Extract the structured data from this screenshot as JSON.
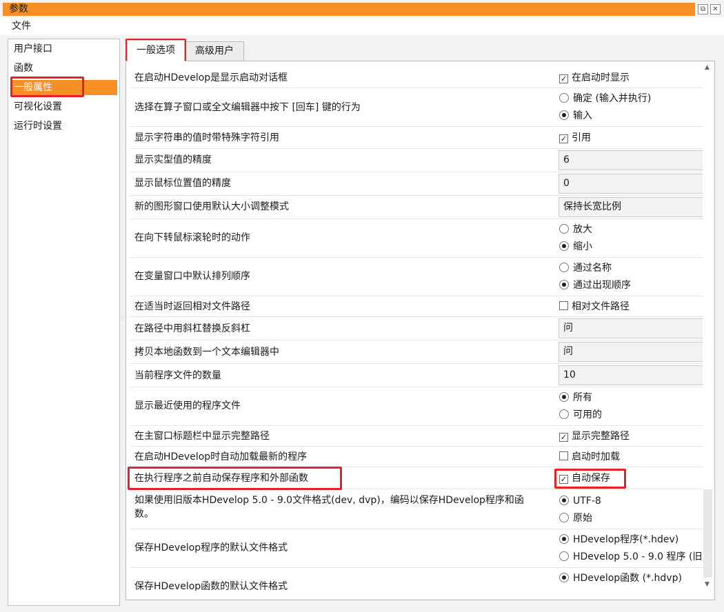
{
  "window": {
    "title": "参数",
    "restore_icon": "⧉",
    "close_icon": "✕"
  },
  "menu": {
    "file": "文件"
  },
  "sidebar": {
    "items": [
      {
        "label": "用户接口"
      },
      {
        "label": "函数"
      },
      {
        "label": "一般属性"
      },
      {
        "label": "可视化设置"
      },
      {
        "label": "运行时设置"
      }
    ]
  },
  "tabs": [
    {
      "label": "一般选项"
    },
    {
      "label": "高级用户"
    }
  ],
  "settings": [
    {
      "label": "在启动HDevelop是显示启动对话框",
      "checkbox_label": "在启动时显示",
      "checked": true
    },
    {
      "label": "选择在算子窗口或全文编辑器中按下 [回车] 键的行为",
      "options": [
        "确定 (输入并执行)",
        "输入"
      ],
      "selected": 1
    },
    {
      "label": "显示字符串的值时带特殊字符引用",
      "checkbox_label": "引用",
      "checked": true
    },
    {
      "label": "显示实型值的精度",
      "value": "6"
    },
    {
      "label": "显示鼠标位置值的精度",
      "value": "0"
    },
    {
      "label": "新的图形窗口使用默认大小调整模式",
      "value": "保持长宽比例"
    },
    {
      "label": "在向下转鼠标滚轮时的动作",
      "options": [
        "放大",
        "缩小"
      ],
      "selected": 1
    },
    {
      "label": "在变量窗口中默认排列顺序",
      "options": [
        "通过名称",
        "通过出现顺序"
      ],
      "selected": 1
    },
    {
      "label": "在适当时返回相对文件路径",
      "checkbox_label": "相对文件路径",
      "checked": false
    },
    {
      "label": "在路径中用斜杠替换反斜杠",
      "value": "问"
    },
    {
      "label": "拷贝本地函数到一个文本编辑器中",
      "value": "问"
    },
    {
      "label": "当前程序文件的数量",
      "value": "10"
    },
    {
      "label": "显示最近使用的程序文件",
      "options": [
        "所有",
        "可用的"
      ],
      "selected": 0
    },
    {
      "label": "在主窗口标题栏中显示完整路径",
      "checkbox_label": "显示完整路径",
      "checked": true
    },
    {
      "label": "在启动HDevelop时自动加载最新的程序",
      "checkbox_label": "启动时加载",
      "checked": false
    },
    {
      "label": "在执行程序之前自动保存程序和外部函数",
      "checkbox_label": "自动保存",
      "checked": true
    },
    {
      "label": "如果使用旧版本HDevelop 5.0 - 9.0文件格式(dev, dvp)，编码以保存HDevelop程序和函数。",
      "options": [
        "UTF-8",
        "原始"
      ],
      "selected": 0
    },
    {
      "label": "保存HDevelop程序的默认文件格式",
      "options": [
        "HDevelop程序(*.hdev)",
        "HDevelop 5.0 - 9.0 程序 (旧"
      ],
      "selected": 0
    },
    {
      "label": "保存HDevelop函数的默认文件格式",
      "options": [
        "HDevelop函数 (*.hdvp)"
      ],
      "selected": 0
    }
  ],
  "check_mark": "✓",
  "scroll": {
    "up_icon": "▲",
    "down_icon": "▼"
  },
  "colors": {
    "accent": "#f58f26",
    "highlight_box": "#e8202a"
  }
}
